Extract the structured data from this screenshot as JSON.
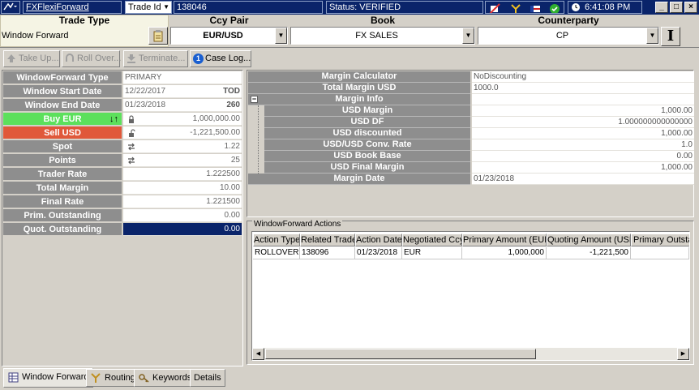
{
  "titlebar": {
    "app_name": "FXFlexiForward",
    "id_label": "Trade Id",
    "trade_id": "138046",
    "status": "Status: VERIFIED",
    "time": "6:41:08 PM",
    "minimize": "_",
    "restore": "□",
    "close": "×"
  },
  "header": {
    "trade_type_label": "Trade Type",
    "trade_type_value": "Window Forward",
    "ccy_pair_label": "Ccy Pair",
    "ccy_pair_value": "EUR/USD",
    "book_label": "Book",
    "book_value": "FX SALES",
    "counterparty_label": "Counterparty",
    "counterparty_value": "CP",
    "cp_button": "I"
  },
  "toolbar": {
    "take_up": "Take Up...",
    "roll_over": "Roll Over...",
    "terminate": "Terminate...",
    "case_log": "Case Log...",
    "case_log_badge": "1"
  },
  "left_fields": [
    {
      "label": "WindowForward Type",
      "value": "PRIMARY",
      "align": "left"
    },
    {
      "label": "Window Start Date",
      "value": "12/22/2017",
      "align": "left",
      "extra": "TOD"
    },
    {
      "label": "Window End Date",
      "value": "01/23/2018",
      "align": "left",
      "extra": "260"
    },
    {
      "label": "Buy EUR",
      "value": "1,000,000.00",
      "align": "right",
      "icon": "lock-icon"
    },
    {
      "label": "Sell USD",
      "value": "-1,221,500.00",
      "align": "right",
      "icon": "unlock-icon"
    },
    {
      "label": "Spot",
      "value": "1.22",
      "align": "right",
      "icon": "refresh-icon"
    },
    {
      "label": "Points",
      "value": "25",
      "align": "right",
      "icon": "refresh-icon"
    },
    {
      "label": "Trader Rate",
      "value": "1.222500",
      "align": "right"
    },
    {
      "label": "Total Margin",
      "value": "10.00",
      "align": "right"
    },
    {
      "label": "Final Rate",
      "value": "1.221500",
      "align": "right"
    },
    {
      "label": "Prim. Outstanding",
      "value": "0.00",
      "align": "right"
    },
    {
      "label": "Quot. Outstanding",
      "value": "0.00",
      "align": "right"
    }
  ],
  "buy_swap_symbol": "↓↑",
  "margin_fields": [
    {
      "label": "Margin Calculator",
      "value": "NoDiscounting",
      "align": "left"
    },
    {
      "label": "Total Margin USD",
      "value": "1000.0",
      "align": "left"
    },
    {
      "label": "Margin Info",
      "value": "",
      "align": "left",
      "collapse": "−"
    },
    {
      "label": "USD Margin",
      "value": "1,000.00",
      "align": "right"
    },
    {
      "label": "USD DF",
      "value": "1.000000000000000",
      "align": "right"
    },
    {
      "label": "USD discounted",
      "value": "1,000.00",
      "align": "right"
    },
    {
      "label": "USD/USD Conv. Rate",
      "value": "1.0",
      "align": "right"
    },
    {
      "label": "USD Book Base",
      "value": "0.00",
      "align": "right"
    },
    {
      "label": "USD Final Margin",
      "value": "1,000.00",
      "align": "right"
    },
    {
      "label": "Margin Date",
      "value": "01/23/2018",
      "align": "left"
    }
  ],
  "actions": {
    "title": "WindowForward Actions",
    "columns": [
      "Action Type",
      "Related Trade",
      "Action Date",
      "Negotiated Ccy",
      "Primary Amount (EUR)",
      "Quoting Amount (USD)",
      "Primary Outstanding"
    ],
    "rows": [
      [
        "ROLLOVER",
        "138096",
        "01/23/2018",
        "EUR",
        "1,000,000",
        "-1,221,500",
        ""
      ]
    ]
  },
  "bottom_tabs": [
    {
      "label": "Window Forward",
      "icon": "grid-icon",
      "active": true
    },
    {
      "label": "Routing",
      "icon": "routing-icon",
      "active": false
    },
    {
      "label": "Keywords",
      "icon": "keywords-icon",
      "active": false
    },
    {
      "label": "Details",
      "icon": "",
      "active": false
    }
  ],
  "colors": {
    "title_bar": "#0a246a",
    "buy": "#5ce05c",
    "sell": "#e0583a",
    "label_gray": "#8e8e8e",
    "highlight": "#0a246a"
  }
}
